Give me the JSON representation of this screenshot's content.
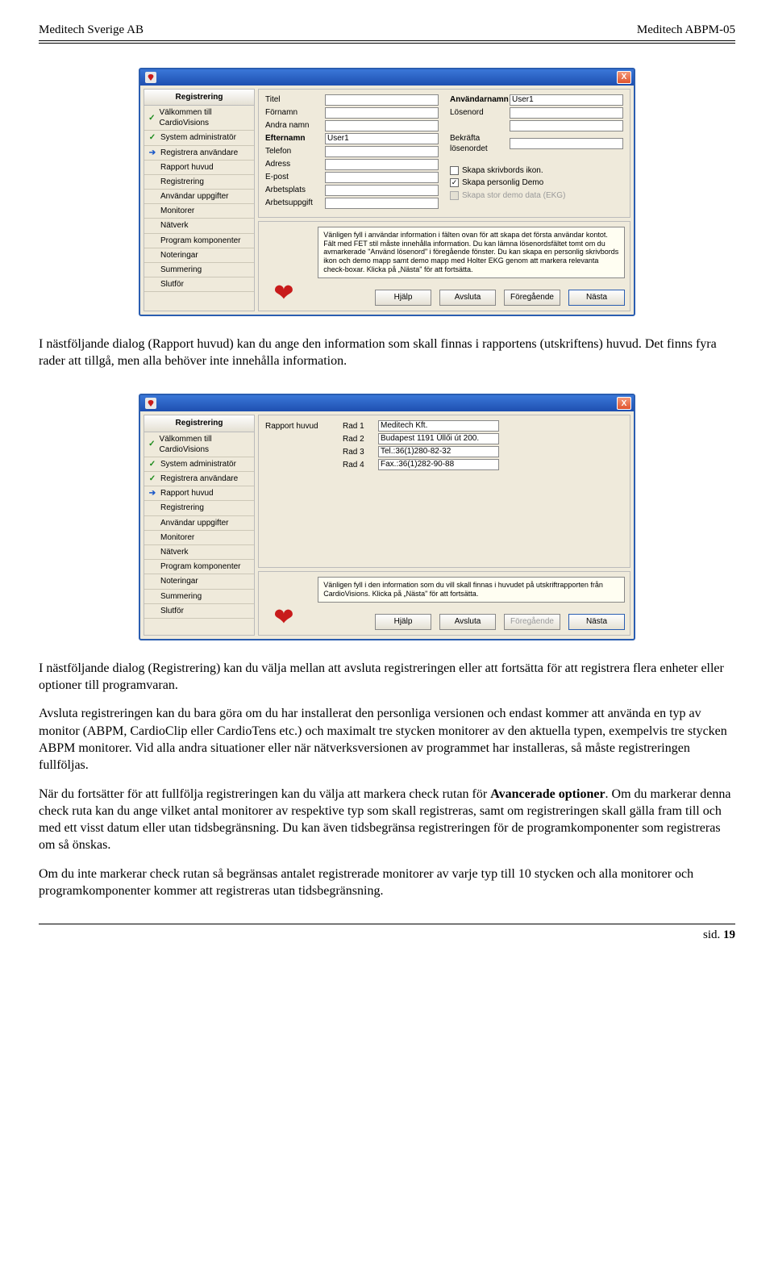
{
  "header": {
    "left": "Meditech Sverige AB",
    "right": "Meditech ABPM-05"
  },
  "footer": {
    "page_label": "sid.",
    "page_number": "19"
  },
  "screenshot1": {
    "close": "X",
    "sidebar_title": "Registrering",
    "sidebar_items": [
      {
        "icon": "check",
        "label": "Välkommen till CardioVisions"
      },
      {
        "icon": "check",
        "label": "System administratör"
      },
      {
        "icon": "arrow",
        "label": "Registrera användare"
      },
      {
        "icon": "",
        "label": "Rapport huvud"
      },
      {
        "icon": "",
        "label": "Registrering"
      },
      {
        "icon": "",
        "label": "Användar uppgifter"
      },
      {
        "icon": "",
        "label": "Monitorer"
      },
      {
        "icon": "",
        "label": "Nätverk"
      },
      {
        "icon": "",
        "label": "Program komponenter"
      },
      {
        "icon": "",
        "label": "Noteringar"
      },
      {
        "icon": "",
        "label": "Summering"
      },
      {
        "icon": "",
        "label": "Slutför"
      }
    ],
    "form_left": [
      {
        "label": "Titel",
        "value": "",
        "bold": false
      },
      {
        "label": "Förnamn",
        "value": "",
        "bold": false
      },
      {
        "label": "Andra namn",
        "value": "",
        "bold": false
      },
      {
        "label": "Efternamn",
        "value": "User1",
        "bold": true
      },
      {
        "label": "Telefon",
        "value": "",
        "bold": false
      },
      {
        "label": "Adress",
        "value": "",
        "bold": false
      },
      {
        "label": "E-post",
        "value": "",
        "bold": false
      },
      {
        "label": "Arbetsplats",
        "value": "",
        "bold": false
      },
      {
        "label": "Arbetsuppgift",
        "value": "",
        "bold": false
      }
    ],
    "form_right": [
      {
        "label": "Användarnamn",
        "value": "User1",
        "bold": true
      },
      {
        "label": "Lösenord",
        "value": "",
        "bold": false
      },
      {
        "label": "",
        "value": "",
        "bold": false
      },
      {
        "label": "Bekräfta lösenordet",
        "value": "",
        "bold": false
      }
    ],
    "checkboxes": [
      {
        "label": "Skapa skrivbords ikon.",
        "checked": false,
        "disabled": false
      },
      {
        "label": "Skapa personlig Demo",
        "checked": true,
        "disabled": false
      },
      {
        "label": "Skapa stor demo data (EKG)",
        "checked": false,
        "disabled": true
      }
    ],
    "hint": "Vänligen fyll i användar information i fälten ovan för att skapa det första användar kontot. Fält med FET stil måste innehålla information. Du kan lämna lösenordsfältet tomt om du avmarkerade \"Använd lösenord\" i föregående fönster. Du kan skapa en personlig skrivbords ikon och demo mapp samt demo mapp med Holter EKG genom att markera relevanta check-boxar. Klicka på „Nästa\" för att fortsätta.",
    "buttons": {
      "help": "Hjälp",
      "cancel": "Avsluta",
      "prev": "Föregående",
      "next": "Nästa"
    }
  },
  "para1": "I nästföljande dialog (Rapport huvud) kan du ange den information som skall finnas i rapportens (utskriftens) huvud. Det finns fyra rader att tillgå, men alla behöver inte innehålla information.",
  "screenshot2": {
    "close": "X",
    "sidebar_title": "Registrering",
    "sidebar_items": [
      {
        "icon": "check",
        "label": "Välkommen till CardioVisions"
      },
      {
        "icon": "check",
        "label": "System administratör"
      },
      {
        "icon": "check",
        "label": "Registrera användare"
      },
      {
        "icon": "arrow",
        "label": "Rapport huvud"
      },
      {
        "icon": "",
        "label": "Registrering"
      },
      {
        "icon": "",
        "label": "Användar uppgifter"
      },
      {
        "icon": "",
        "label": "Monitorer"
      },
      {
        "icon": "",
        "label": "Nätverk"
      },
      {
        "icon": "",
        "label": "Program komponenter"
      },
      {
        "icon": "",
        "label": "Noteringar"
      },
      {
        "icon": "",
        "label": "Summering"
      },
      {
        "icon": "",
        "label": "Slutför"
      }
    ],
    "section_label": "Rapport huvud",
    "rows": [
      {
        "rad": "Rad 1",
        "value": "Meditech Kft."
      },
      {
        "rad": "Rad 2",
        "value": "Budapest 1191 Üllői út 200."
      },
      {
        "rad": "Rad 3",
        "value": "Tel.:36(1)280-82-32"
      },
      {
        "rad": "Rad 4",
        "value": "Fax.:36(1)282-90-88"
      }
    ],
    "hint": "Vänligen fyll i den information som du vill skall finnas i huvudet på utskriftrapporten från CardioVisions. Klicka på „Nästa\" för att fortsätta.",
    "buttons": {
      "help": "Hjälp",
      "cancel": "Avsluta",
      "prev": "Föregående",
      "next": "Nästa"
    }
  },
  "para2": "I nästföljande dialog (Registrering) kan du välja mellan att avsluta registreringen eller att fortsätta för att registrera flera enheter eller optioner till programvaran.",
  "para3": "Avsluta registreringen kan du bara göra om du har installerat den personliga versionen och endast kommer att använda en typ av monitor (ABPM, CardioClip eller CardioTens etc.) och maximalt tre stycken monitorer av den aktuella typen, exempelvis tre stycken ABPM monitorer. Vid alla andra situationer eller när nätverksversionen av programmet har installeras, så måste registreringen fullföljas.",
  "para4_a": "När du fortsätter för att fullfölja registreringen kan du välja att markera check rutan för ",
  "para4_b": "Avancerade optioner",
  "para4_c": ". Om du markerar denna check ruta kan du ange vilket antal monitorer av respektive typ som skall registreras, samt om registreringen skall gälla fram till och med ett visst datum eller utan tidsbegränsning. Du kan även tidsbegränsa registreringen för de programkomponenter som registreras om så önskas.",
  "para5": "Om du inte markerar check rutan så begränsas antalet registrerade monitorer av varje typ till 10 stycken och alla monitorer och programkomponenter kommer att registreras utan tidsbegränsning."
}
